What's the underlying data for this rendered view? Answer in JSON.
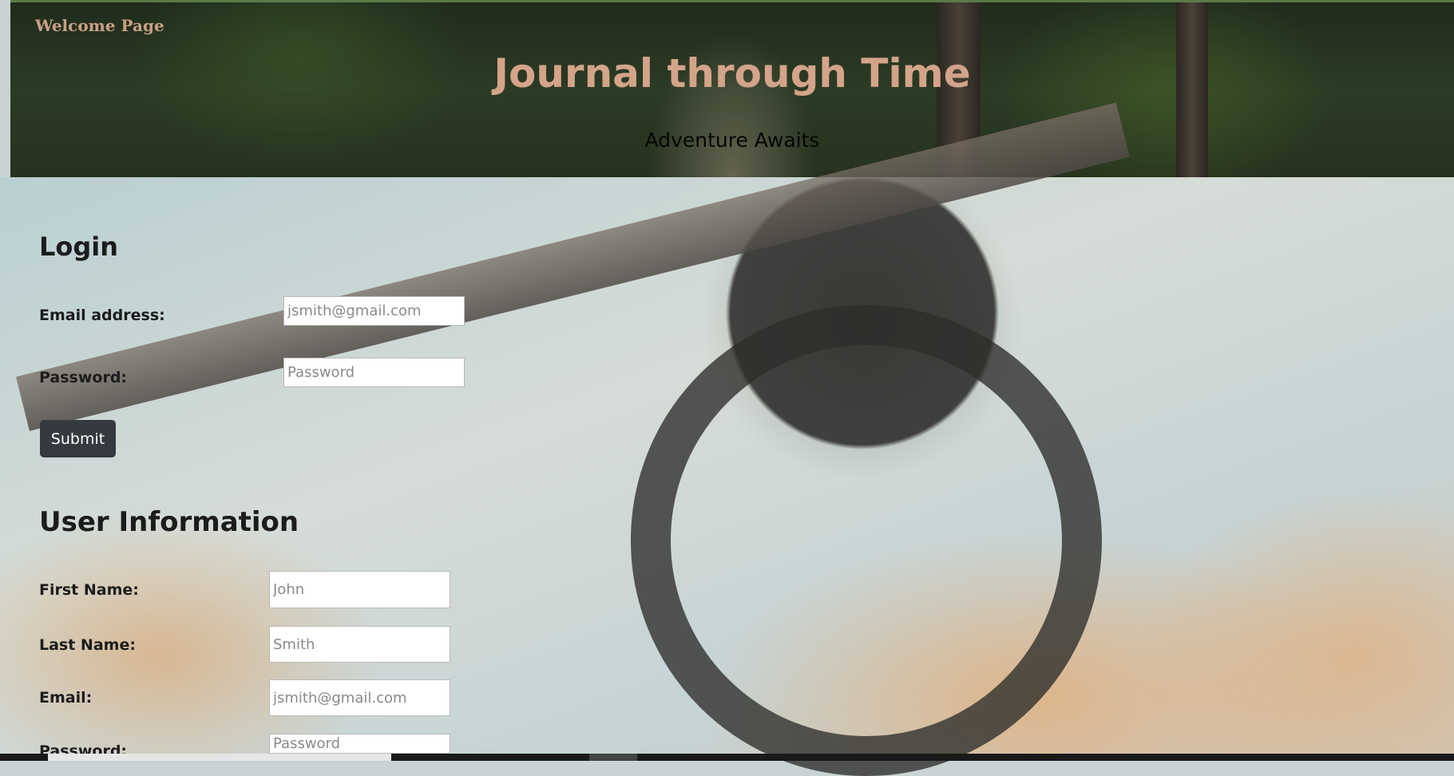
{
  "nav": {
    "welcome_link": "Welcome Page"
  },
  "hero": {
    "title": "Journal through Time",
    "tagline": "Adventure Awaits"
  },
  "login": {
    "heading": "Login",
    "email_label": "Email address:",
    "email_placeholder": "jsmith@gmail.com",
    "password_label": "Password:",
    "password_placeholder": "Password",
    "submit_label": "Submit"
  },
  "user_info": {
    "heading": "User Information",
    "first_name_label": "First Name:",
    "first_name_placeholder": "John",
    "last_name_label": "Last Name:",
    "last_name_placeholder": "Smith",
    "email_label": "Email:",
    "email_placeholder": "jsmith@gmail.com",
    "password_label": "Password:",
    "password_placeholder": "Password"
  },
  "colors": {
    "title": "#d3a48a",
    "welcome_link": "#c9a085",
    "button": "#343a40"
  }
}
